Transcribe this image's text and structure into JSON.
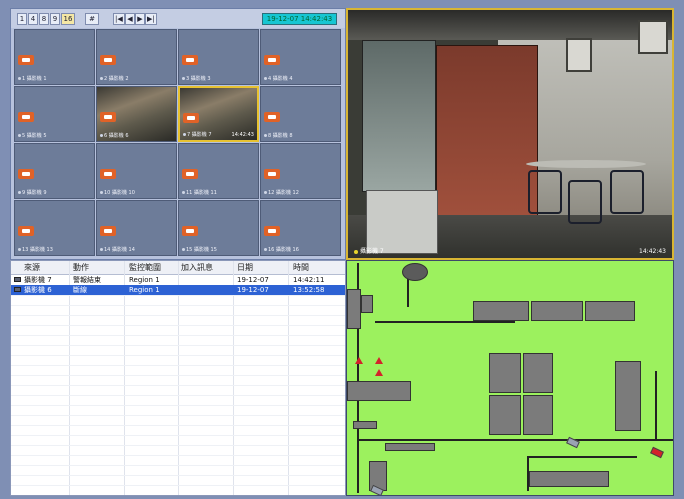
{
  "toolbar": {
    "layout_buttons": [
      "1",
      "4",
      "8",
      "9",
      "16",
      "#"
    ],
    "nav_buttons": [
      "|◀",
      "◀",
      "▶",
      "▶|"
    ],
    "clock": "19-12-07  14:42:43"
  },
  "camera_grid": {
    "tiles": [
      {
        "num": "1",
        "label": "攝影機 1"
      },
      {
        "num": "2",
        "label": "攝影機 2"
      },
      {
        "num": "3",
        "label": "攝影機 3"
      },
      {
        "num": "4",
        "label": "攝影機 4"
      },
      {
        "num": "5",
        "label": "攝影機 5"
      },
      {
        "num": "6",
        "label": "攝影機 6",
        "photo": true
      },
      {
        "num": "7",
        "label": "攝影機 7",
        "photo": true,
        "active": true,
        "time": "14:42:43"
      },
      {
        "num": "8",
        "label": "攝影機 8"
      },
      {
        "num": "9",
        "label": "攝影機 9"
      },
      {
        "num": "10",
        "label": "攝影機 10"
      },
      {
        "num": "11",
        "label": "攝影機 11"
      },
      {
        "num": "12",
        "label": "攝影機 12"
      },
      {
        "num": "13",
        "label": "攝影機 13"
      },
      {
        "num": "14",
        "label": "攝影機 14"
      },
      {
        "num": "15",
        "label": "攝影機 15"
      },
      {
        "num": "16",
        "label": "攝影機 16"
      }
    ]
  },
  "big_view": {
    "label": "攝影機 7",
    "time": "14:42:43"
  },
  "events": {
    "headers": [
      "來源",
      "動作",
      "監控範圍",
      "加入訊息",
      "日期",
      "時間"
    ],
    "rows": [
      {
        "source": "攝影機 7",
        "action": "警報結束",
        "region": "Region 1",
        "message": "",
        "date": "19-12-07",
        "time": "14:42:11",
        "selected": false
      },
      {
        "source": "攝影機 6",
        "action": "斷線",
        "region": "Region 1",
        "message": "",
        "date": "19-12-07",
        "time": "13:52:58",
        "selected": true
      }
    ]
  },
  "colors": {
    "accent_clock": "#17c6d2",
    "selection": "#2d62d4",
    "map_floor": "#9cf15e",
    "active_border": "#e7c230"
  }
}
